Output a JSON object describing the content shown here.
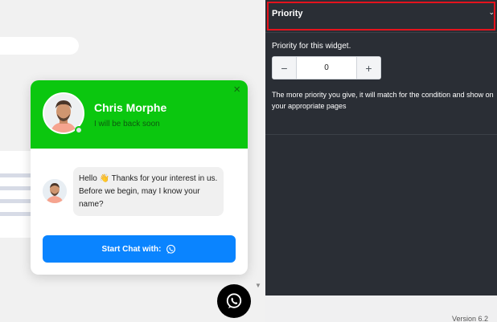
{
  "widget": {
    "agent_name": "Chris Morphe",
    "agent_status": "I will be back soon",
    "close_glyph": "×",
    "message": "Hello 👋 Thanks for your interest in us. Before we begin, may I know your name?",
    "start_button_label": "Start Chat with:",
    "header_color": "#0bc70f",
    "button_color": "#0a84ff",
    "icons": [
      "whatsapp-icon",
      "close-icon"
    ]
  },
  "settings": {
    "section_title": "Priority",
    "chevron": "⌄",
    "field_label": "Priority for this widget.",
    "minus": "−",
    "plus": "+",
    "value": "0",
    "help_text": "The more priority you give, it will match for the condition and show on your appropriate pages"
  },
  "footer": {
    "version": "Version 6.2"
  }
}
